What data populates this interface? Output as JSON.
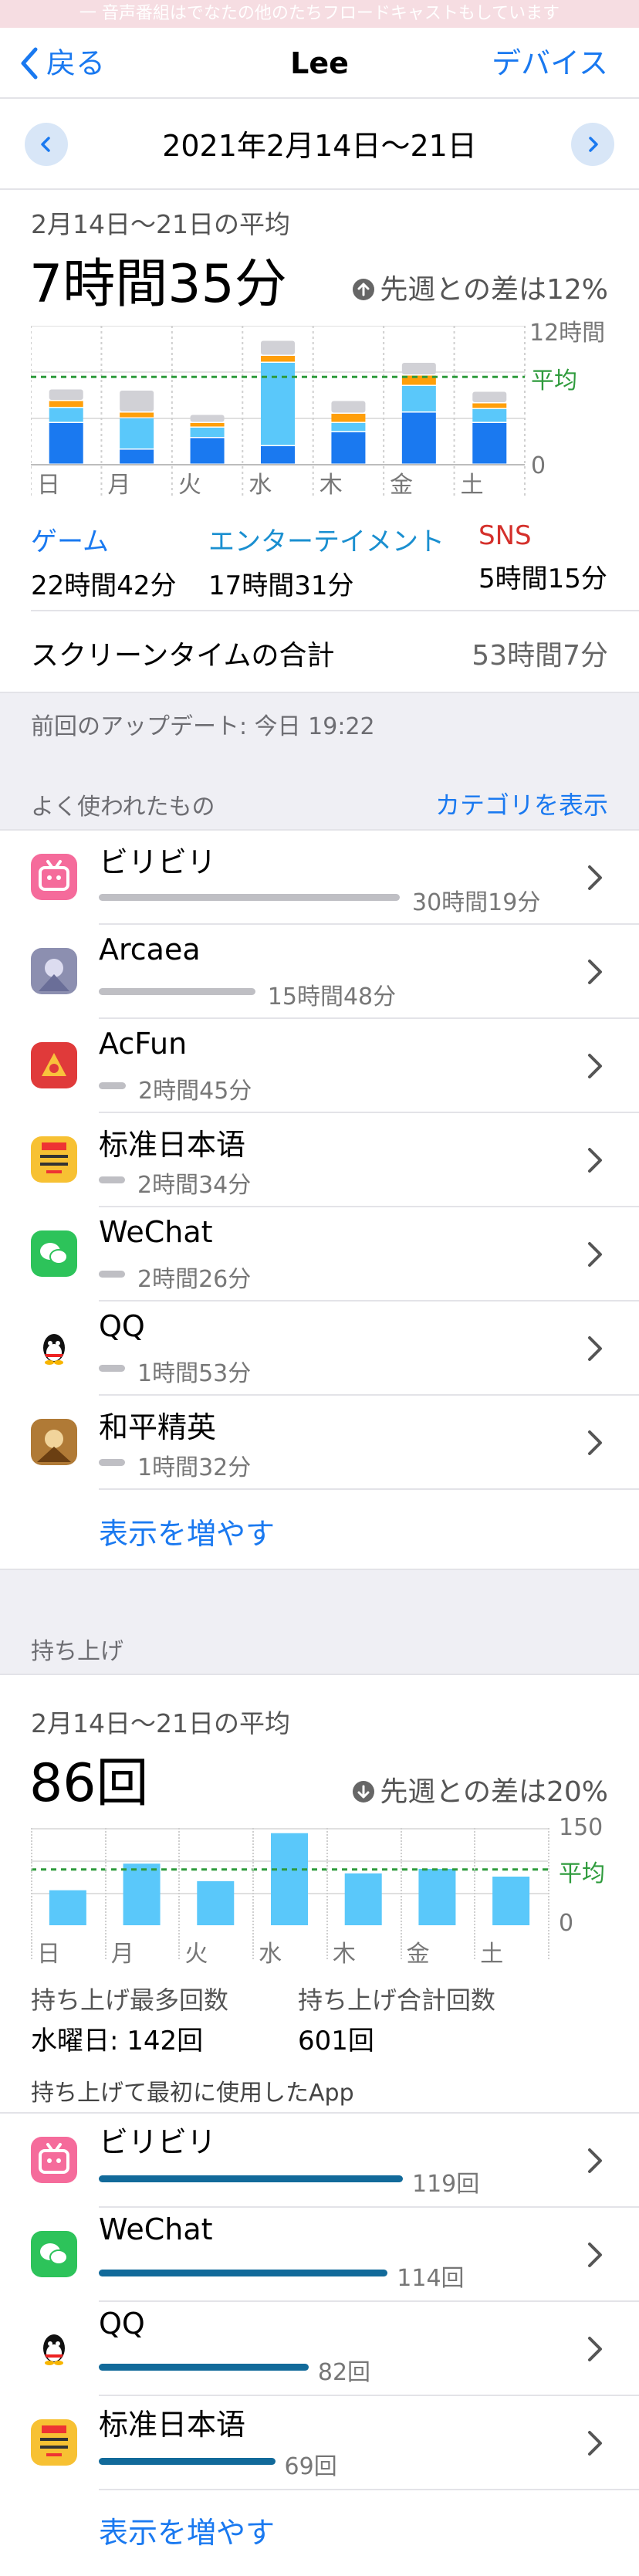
{
  "banner": "一 音声番組はでなたの他のたちフロードキャストもしています",
  "nav": {
    "back": "戻る",
    "title": "Lee",
    "devices": "デバイス"
  },
  "week_range": "2021年2月14日～21日",
  "screen_time": {
    "avg_label": "2月14日～21日の平均",
    "avg_value": "7時間35分",
    "change": "先週との差は12%",
    "ytop": "12時間",
    "avg_tag": "平均",
    "yzero": "0",
    "days": [
      "日",
      "月",
      "火",
      "水",
      "木",
      "金",
      "土"
    ],
    "categories": [
      {
        "name": "ゲーム",
        "time": "22時間42分",
        "color": "#1a79f0"
      },
      {
        "name": "エンターテイメント",
        "time": "17時間31分",
        "color": "#1a8fd0"
      },
      {
        "name": "SNS",
        "time": "5時間15分",
        "color": "#d4302b"
      }
    ],
    "total_label": "スクリーンタイムの合計",
    "total_value": "53時間7分"
  },
  "chart_data": [
    {
      "type": "bar",
      "categories": [
        "日",
        "月",
        "火",
        "水",
        "木",
        "金",
        "土"
      ],
      "series": [
        {
          "values": [
            3.6,
            1.3,
            2.3,
            1.6,
            2.8,
            4.5,
            3.6
          ]
        },
        {
          "values": [
            1.3,
            2.7,
            0.9,
            7.2,
            0.8,
            2.3,
            1.2
          ]
        },
        {
          "values": [
            0.6,
            0.5,
            0.4,
            0.6,
            0.8,
            0.9,
            0.5
          ]
        },
        {
          "values": [
            1.0,
            1.9,
            0.7,
            1.3,
            1.1,
            1.1,
            1.0
          ]
        }
      ],
      "ylim": [
        0,
        12
      ],
      "average": 7.58,
      "colors": [
        "#1a79f0",
        "#5ac8fa",
        "#ff9f0a",
        "#d1d1d6"
      ]
    },
    {
      "type": "bar",
      "categories": [
        "日",
        "月",
        "火",
        "水",
        "木",
        "金",
        "土"
      ],
      "values": [
        54,
        95,
        68,
        142,
        80,
        87,
        75
      ],
      "ylim": [
        0,
        150
      ],
      "average": 86,
      "colors": [
        "#5ac8fa"
      ]
    }
  ],
  "last_update": "前回のアップデート: 今日 19:22",
  "most_used": {
    "label": "よく使われたもの",
    "show_categories": "カテゴリを表示",
    "apps": [
      {
        "name": "ビリビリ",
        "time": "30時間19分",
        "icon": "bilibili-icon",
        "color": "#f56b9b",
        "fraction": 1.0
      },
      {
        "name": "Arcaea",
        "time": "15時間48分",
        "icon": "arcaea-icon",
        "color": "#8c8fb0",
        "fraction": 0.52
      },
      {
        "name": "AcFun",
        "time": "2時間45分",
        "icon": "acfun-icon",
        "color": "#e03a3a",
        "fraction": 0.09
      },
      {
        "name": "标准日本语",
        "time": "2時間34分",
        "icon": "nihongo-icon",
        "color": "#f7c133",
        "fraction": 0.085
      },
      {
        "name": "WeChat",
        "time": "2時間26分",
        "icon": "wechat-icon",
        "color": "#2dc35a",
        "fraction": 0.08
      },
      {
        "name": "QQ",
        "time": "1時間53分",
        "icon": "qq-icon",
        "color": "#ffffff",
        "fraction": 0.062
      },
      {
        "name": "和平精英",
        "time": "1時間32分",
        "icon": "peacekeeper-icon",
        "color": "#b07a36",
        "fraction": 0.05
      }
    ],
    "show_more": "表示を増やす"
  },
  "pickups": {
    "section": "持ち上げ",
    "avg_label": "2月14日～21日の平均",
    "avg_value": "86回",
    "change": "先週との差は20%",
    "ytop": "150",
    "avg_tag": "平均",
    "yzero": "0",
    "days": [
      "日",
      "月",
      "火",
      "水",
      "木",
      "金",
      "土"
    ],
    "most_label": "持ち上げ最多回数",
    "most_value": "水曜日: 142回",
    "total_label": "持ち上げ合計回数",
    "total_value": "601回",
    "first_label": "持ち上げて最初に使用したApp",
    "apps": [
      {
        "name": "ビリビリ",
        "count": "119回",
        "icon": "bilibili-icon",
        "color": "#f56b9b",
        "fraction": 1.0
      },
      {
        "name": "WeChat",
        "count": "114回",
        "icon": "wechat-icon",
        "color": "#2dc35a",
        "fraction": 0.95
      },
      {
        "name": "QQ",
        "count": "82回",
        "icon": "qq-icon",
        "color": "#ffffff",
        "fraction": 0.69
      },
      {
        "name": "标准日本语",
        "count": "69回",
        "icon": "nihongo-icon",
        "color": "#f7c133",
        "fraction": 0.58
      }
    ],
    "show_more": "表示を増やす"
  }
}
